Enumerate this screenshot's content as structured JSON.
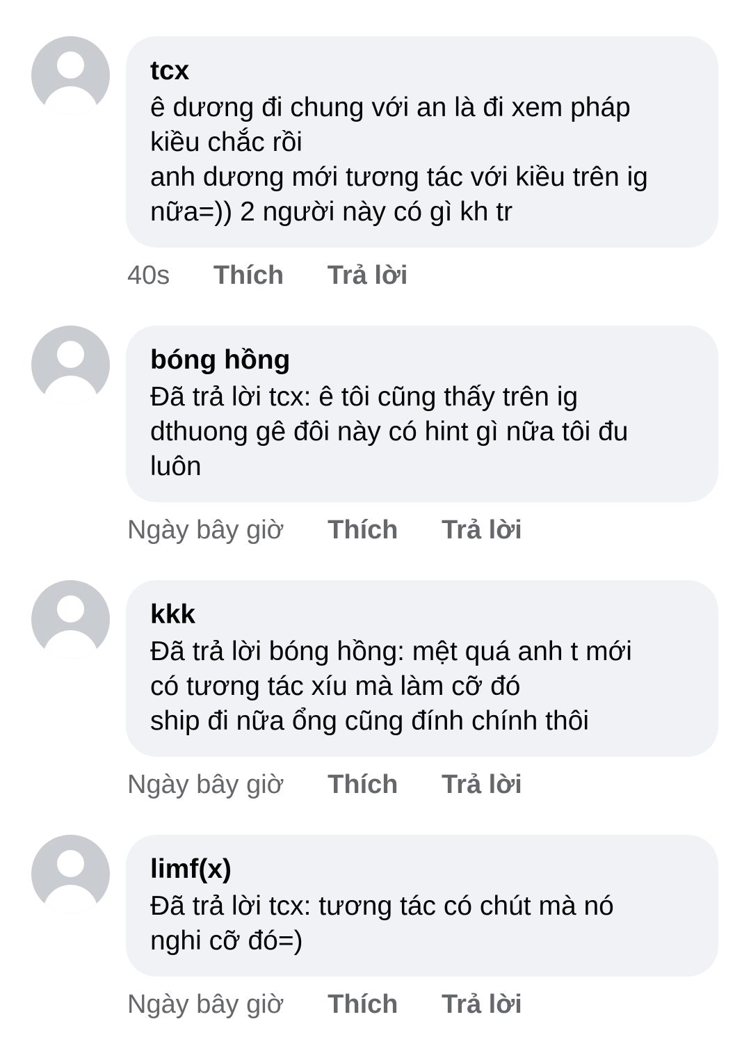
{
  "comments": [
    {
      "author": "tcx",
      "lines": [
        "ê dương đi chung với an là đi xem pháp",
        "kiều chắc rồi",
        "anh dương mới tương tác với kiều trên ig",
        "nữa=)) 2 người này có gì kh tr"
      ],
      "time": "40s",
      "like_label": "Thích",
      "reply_label": "Trả lời"
    },
    {
      "author": "bóng hồng",
      "lines": [
        "Đã trả lời tcx: ê tôi cũng thấy trên ig",
        "dthuong gê đôi này có hint gì nữa tôi đu",
        "luôn"
      ],
      "time": "Ngày bây giờ",
      "like_label": "Thích",
      "reply_label": "Trả lời"
    },
    {
      "author": "kkk",
      "lines": [
        "Đã trả lời bóng hồng: mệt quá anh t mới",
        "có tương tác xíu mà làm cỡ đó",
        "ship đi nữa ổng cũng đính chính thôi"
      ],
      "time": "Ngày bây giờ",
      "like_label": "Thích",
      "reply_label": "Trả lời"
    },
    {
      "author": "limf(x)",
      "lines": [
        "Đã trả lời tcx: tương tác có chút mà nó",
        "nghi cỡ đó=)"
      ],
      "time": "Ngày bây giờ",
      "like_label": "Thích",
      "reply_label": "Trả lời"
    }
  ]
}
